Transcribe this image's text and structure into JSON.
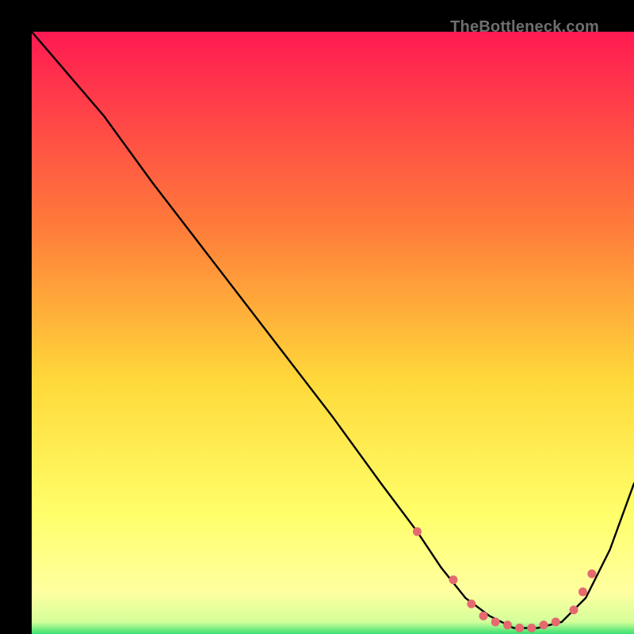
{
  "attribution": "TheBottleneck.com",
  "colors": {
    "grad_top": "#ff1a52",
    "grad_mid_upper": "#ff7a3a",
    "grad_mid": "#ffd93a",
    "grad_lower": "#ffff6a",
    "grad_pale": "#ffffa0",
    "grad_green": "#38e070",
    "curve": "#000000",
    "marker": "#e46a6f"
  },
  "chart_data": {
    "type": "line",
    "title": "",
    "xlabel": "",
    "ylabel": "",
    "xlim": [
      0,
      100
    ],
    "ylim": [
      0,
      100
    ],
    "series": [
      {
        "name": "bottleneck-curve",
        "x": [
          0,
          6,
          12,
          20,
          30,
          40,
          50,
          58,
          64,
          68,
          72,
          76,
          80,
          84,
          88,
          92,
          96,
          100
        ],
        "y": [
          100,
          93,
          86,
          75,
          62,
          49,
          36,
          25,
          17,
          11,
          6,
          3,
          1,
          1,
          2,
          6,
          14,
          25
        ]
      }
    ],
    "markers": {
      "name": "highlight-dots",
      "x": [
        64,
        70,
        73,
        75,
        77,
        79,
        81,
        83,
        85,
        87,
        90,
        91.5,
        93
      ],
      "y": [
        17,
        9,
        5,
        3,
        2,
        1.5,
        1,
        1,
        1.5,
        2,
        4,
        7,
        10
      ]
    }
  }
}
